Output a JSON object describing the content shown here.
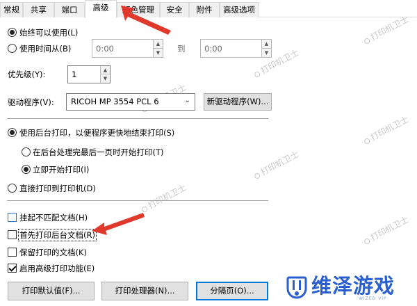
{
  "tabs": [
    {
      "label": "常规"
    },
    {
      "label": "共享"
    },
    {
      "label": "端口"
    },
    {
      "label": "高级"
    },
    {
      "label": "颜色管理"
    },
    {
      "label": "安全"
    },
    {
      "label": "附件"
    },
    {
      "label": "高级选项"
    }
  ],
  "active_tab": "高级",
  "availability": {
    "always_label": "始终可以使用(L)",
    "from_label": "使用时间从(B)",
    "from_value": "0:00",
    "to_label": "到",
    "to_value": "0:00",
    "selected": "always"
  },
  "priority": {
    "label": "优先级(Y):",
    "value": "1"
  },
  "driver": {
    "label": "驱动程序(V):",
    "value": "RICOH MP 3554 PCL 6",
    "new_button": "新驱动程序(W)..."
  },
  "spool": {
    "spool_label": "使用后台打印，以便程序更快地结束打印(S)",
    "after_last_page_label": "在后台处理完最后一页时开始打印(T)",
    "immediately_label": "立即开始打印(I)",
    "direct_label": "直接打印到打印机(D)",
    "selected": "spool",
    "spool_option": "immediately"
  },
  "options": [
    {
      "label": "挂起不匹配文档(H)",
      "checked": false
    },
    {
      "label": "首先打印后台文档(R)",
      "checked": false
    },
    {
      "label": "保留打印的文档(K)",
      "checked": false
    },
    {
      "label": "启用高级打印功能(E)",
      "checked": true
    }
  ],
  "bottom_buttons": {
    "defaults": "打印默认值(F)...",
    "processor": "打印处理器(N)...",
    "separator": "分隔页(O)..."
  },
  "watermark": {
    "text": "打印机卫士"
  },
  "brand": {
    "name": "维泽游戏",
    "sub": "WIZED VIP",
    "color": "#2a5fd0"
  },
  "colors": {
    "arrow": "#e0392b",
    "focus_blue": "#0078d7"
  }
}
